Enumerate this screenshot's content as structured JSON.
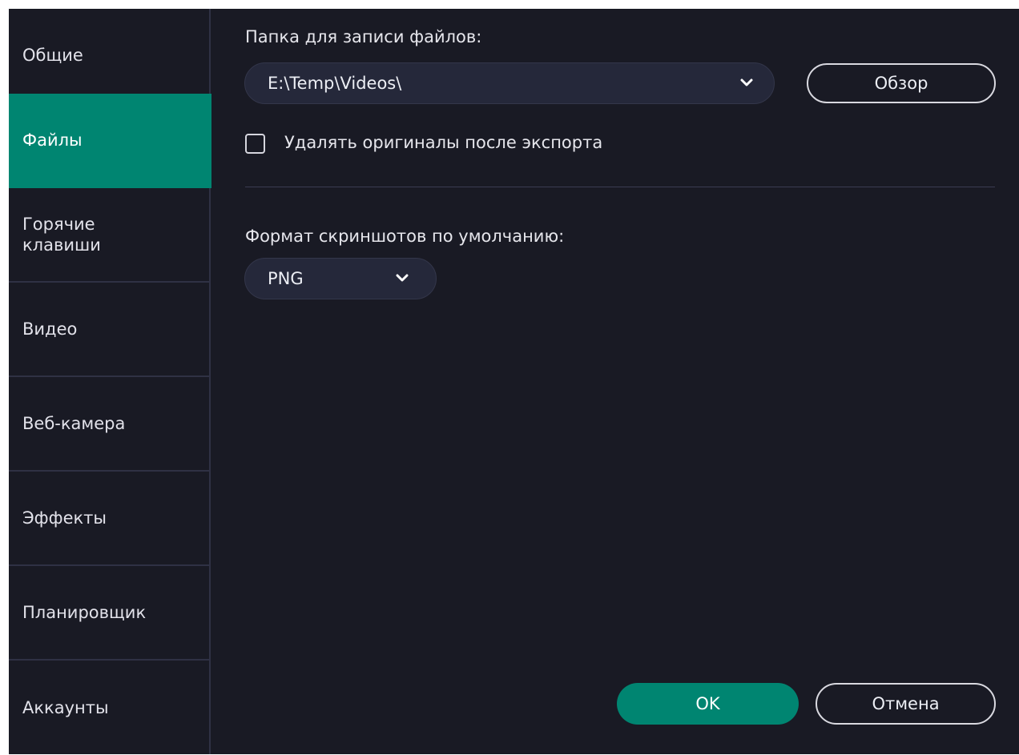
{
  "sidebar": {
    "items": [
      {
        "label": "Общие",
        "active": false
      },
      {
        "label": "Файлы",
        "active": true
      },
      {
        "label": "Горячие\nклавиши",
        "active": false
      },
      {
        "label": "Видео",
        "active": false
      },
      {
        "label": "Веб-камера",
        "active": false
      },
      {
        "label": "Эффекты",
        "active": false
      },
      {
        "label": "Планировщик",
        "active": false
      },
      {
        "label": "Аккаунты",
        "active": false
      }
    ]
  },
  "files": {
    "folder_label": "Папка для записи файлов:",
    "folder_value": "E:\\Temp\\Videos\\",
    "browse_label": "Обзор",
    "delete_originals_label": "Удалять оригиналы после экспорта",
    "delete_originals_checked": false,
    "screenshot_format_label": "Формат скриншотов по умолчанию:",
    "screenshot_format_value": "PNG"
  },
  "footer": {
    "ok_label": "OK",
    "cancel_label": "Отмена"
  },
  "colors": {
    "accent": "#008571",
    "background": "#191a24",
    "control_bg": "#25283a",
    "divider": "#2f3144"
  }
}
